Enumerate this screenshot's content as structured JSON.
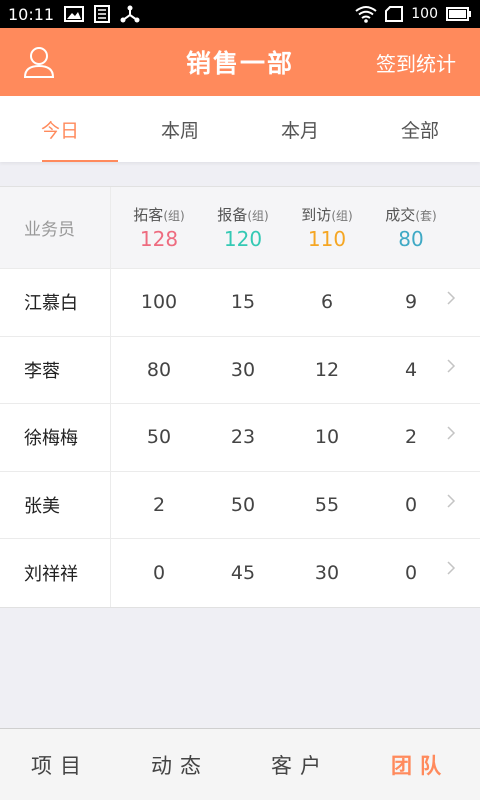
{
  "status_bar": {
    "time": "10:11",
    "battery": "100"
  },
  "header": {
    "title": "销售一部",
    "action": "签到统计"
  },
  "tabs": [
    {
      "label": "今日",
      "active": true
    },
    {
      "label": "本周",
      "active": false
    },
    {
      "label": "本月",
      "active": false
    },
    {
      "label": "全部",
      "active": false
    }
  ],
  "table": {
    "name_header": "业务员",
    "columns": [
      {
        "label": "拓客",
        "unit": "(组)",
        "total": "128",
        "color": "#ee6b7f"
      },
      {
        "label": "报备",
        "unit": "(组)",
        "total": "120",
        "color": "#34c9b4"
      },
      {
        "label": "到访",
        "unit": "(组)",
        "total": "110",
        "color": "#f5a623"
      },
      {
        "label": "成交",
        "unit": "(套)",
        "total": "80",
        "color": "#3fa9c5"
      }
    ],
    "rows": [
      {
        "name": "江慕白",
        "values": [
          "100",
          "15",
          "6",
          "9"
        ]
      },
      {
        "name": "李蓉",
        "values": [
          "80",
          "30",
          "12",
          "4"
        ]
      },
      {
        "name": "徐梅梅",
        "values": [
          "50",
          "23",
          "10",
          "2"
        ]
      },
      {
        "name": "张美",
        "values": [
          "2",
          "50",
          "55",
          "0"
        ]
      },
      {
        "name": "刘祥祥",
        "values": [
          "0",
          "45",
          "30",
          "0"
        ]
      }
    ]
  },
  "bottom_nav": [
    {
      "label": "项目",
      "active": false
    },
    {
      "label": "动态",
      "active": false
    },
    {
      "label": "客户",
      "active": false
    },
    {
      "label": "团队",
      "active": true
    }
  ],
  "colors": {
    "accent": "#ff8a5c"
  }
}
